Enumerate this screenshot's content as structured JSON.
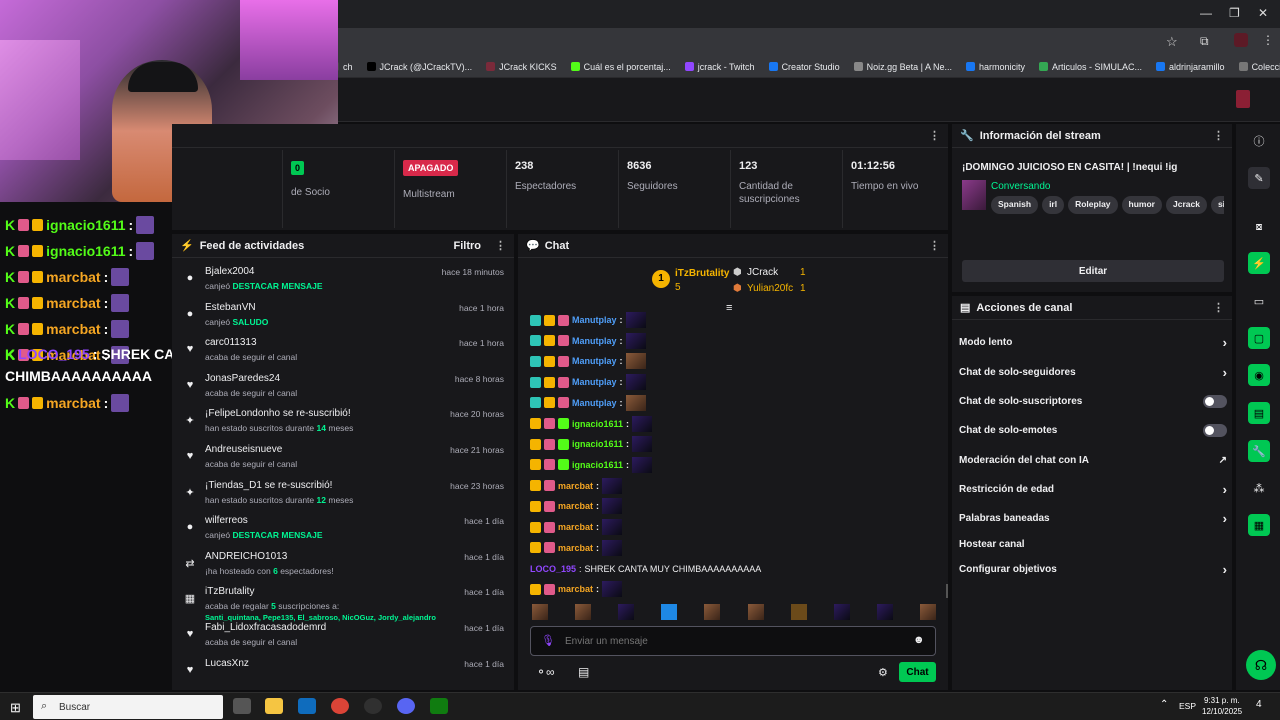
{
  "browser": {
    "bookmarks": [
      {
        "label": "ch",
        "color": "#444"
      },
      {
        "label": "JCrack (@JCrackTV)...",
        "color": "#000"
      },
      {
        "label": "JCrack KICKS",
        "color": "#7a2a3a"
      },
      {
        "label": "Cuál es el porcentaj...",
        "color": "#53fc18"
      },
      {
        "label": "jcrack - Twitch",
        "color": "#9147ff"
      },
      {
        "label": "Creator Studio",
        "color": "#1877f2"
      },
      {
        "label": "Noiz.gg Beta | A Ne...",
        "color": "#888"
      },
      {
        "label": "harmonicity",
        "color": "#1877f2"
      },
      {
        "label": "Articulos - SIMULAC...",
        "color": "#34a853"
      },
      {
        "label": "aldrinjaramillo",
        "color": "#1877f2"
      },
      {
        "label": "Colección de M_blei...",
        "color": "#777"
      }
    ],
    "more": "»"
  },
  "stats": {
    "items": [
      {
        "value": "0",
        "label": "de Socio"
      },
      {
        "value": "APAGADO",
        "label": "Multistream"
      },
      {
        "value": "238",
        "label": "Espectadores"
      },
      {
        "value": "8636",
        "label": "Seguidores"
      },
      {
        "value": "123",
        "label": "Cantidad de suscripciones"
      },
      {
        "value": "01:12:56",
        "label": "Tiempo en vivo"
      }
    ]
  },
  "activity": {
    "title": "Feed de actividades",
    "filter": "Filtro",
    "items": [
      {
        "name": "Bjalex2004",
        "desc": "canjeó",
        "highlight": "DESTACAR MENSAJE",
        "time": "hace 18 minutos",
        "icon": "●"
      },
      {
        "name": "EstebanVN",
        "desc": "canjeó",
        "highlight": "SALUDO",
        "time": "hace 1 hora",
        "icon": "●"
      },
      {
        "name": "carc011313",
        "desc": "acaba de seguir el canal",
        "highlight": "",
        "time": "hace 1 hora",
        "icon": "♥"
      },
      {
        "name": "JonasParedes24",
        "desc": "acaba de seguir el canal",
        "highlight": "",
        "time": "hace 8 horas",
        "icon": "♥"
      },
      {
        "name": "¡FelipeLondonho se re-suscribió!",
        "desc": "han estado suscritos durante",
        "highlight": "14",
        "suffix": "meses",
        "time": "hace 20 horas",
        "icon": "✦"
      },
      {
        "name": "Andreuseisnueve",
        "desc": "acaba de seguir el canal",
        "highlight": "",
        "time": "hace 21 horas",
        "icon": "♥"
      },
      {
        "name": "¡Tiendas_D1 se re-suscribió!",
        "desc": "han estado suscritos durante",
        "highlight": "12",
        "suffix": "meses",
        "time": "hace 23 horas",
        "icon": "✦"
      },
      {
        "name": "wilferreos",
        "desc": "canjeó",
        "highlight": "DESTACAR MENSAJE",
        "time": "hace 1 día",
        "icon": "●"
      },
      {
        "name": "ANDREICHO1013",
        "desc": "¡ha hosteado con",
        "highlight": "6",
        "suffix": "espectadores!",
        "time": "hace 1 día",
        "icon": "⇄"
      },
      {
        "name": "iTzBrutality",
        "desc": "acaba de regalar",
        "highlight": "5",
        "suffix": "suscripciones a:",
        "extra": "Santi_quintana, Pepe135, El_sabroso, NicOGuz, Jordy_alejandro",
        "time": "hace 1 día",
        "icon": "▦"
      },
      {
        "name": "Fabi_Lidoxfracasadodemrd",
        "desc": "acaba de seguir el canal",
        "highlight": "",
        "time": "hace 1 día",
        "icon": "♥"
      },
      {
        "name": "LucasXnz",
        "desc": "",
        "highlight": "",
        "time": "hace 1 día",
        "icon": "♥"
      }
    ]
  },
  "chat": {
    "title": "Chat",
    "top": {
      "first": {
        "name": "iTzBrutality",
        "count": "5"
      },
      "second": {
        "name": "JCrack",
        "count": "1"
      },
      "third": {
        "name": "Yulian20fc",
        "count": "1"
      }
    },
    "messages": [
      {
        "user": "Manutplay",
        "color": "#4f9ef8"
      },
      {
        "user": "Manutplay",
        "color": "#4f9ef8"
      },
      {
        "user": "Manutplay",
        "color": "#4f9ef8"
      },
      {
        "user": "Manutplay",
        "color": "#4f9ef8"
      },
      {
        "user": "Manutplay",
        "color": "#4f9ef8"
      },
      {
        "user": "ignacio1611",
        "color": "#53fc18"
      },
      {
        "user": "ignacio1611",
        "color": "#53fc18"
      },
      {
        "user": "ignacio1611",
        "color": "#53fc18"
      },
      {
        "user": "marcbat",
        "color": "#f5a623"
      },
      {
        "user": "marcbat",
        "color": "#f5a623"
      },
      {
        "user": "marcbat",
        "color": "#f5a623"
      },
      {
        "user": "marcbat",
        "color": "#f5a623"
      }
    ],
    "loco": {
      "user": "LOCO_195",
      "text": "SHREK CANTA MUY CHIMBAAAAAAAAAA"
    },
    "last": {
      "user": "marcbat",
      "color": "#f5a623"
    },
    "placeholder": "Enviar un mensaje",
    "send": "Chat"
  },
  "info": {
    "title": "Información del stream",
    "stream_title": "¡DOMINGO JUICIOSO EN CASITA! | !nequi !ig",
    "category": "Conversando",
    "tags": [
      "Spanish",
      "irl",
      "Roleplay",
      "humor",
      "Jcrack",
      "simula"
    ],
    "edit": "Editar"
  },
  "actions": {
    "title": "Acciones de canal",
    "items": [
      {
        "label": "Modo lento",
        "kind": "chev"
      },
      {
        "label": "Chat de solo-seguidores",
        "kind": "chev"
      },
      {
        "label": "Chat de solo-suscriptores",
        "kind": "toggle"
      },
      {
        "label": "Chat de solo-emotes",
        "kind": "toggle"
      },
      {
        "label": "Moderación del chat con IA",
        "kind": "ext"
      },
      {
        "label": "Restricción de edad",
        "kind": "chev"
      },
      {
        "label": "Palabras baneadas",
        "kind": "chev"
      },
      {
        "label": "Hostear canal",
        "kind": "none"
      },
      {
        "label": "Configurar objetivos",
        "kind": "chev"
      }
    ]
  },
  "overlay": {
    "lines": [
      {
        "user": "ignacio1611",
        "color": "#53fc18",
        "sep": ":"
      },
      {
        "user": "ignacio1611",
        "color": "#53fc18",
        "sep": ":"
      },
      {
        "user": "marcbat",
        "color": "#f5a623",
        "sep": ":"
      },
      {
        "user": "marcbat",
        "color": "#f5a623",
        "sep": ":"
      },
      {
        "user": "marcbat",
        "color": "#f5a623",
        "sep": ":"
      },
      {
        "user": "marcbat",
        "color": "#f5a623",
        "sep": ":"
      }
    ],
    "loco_user": "LOCO_195",
    "loco_text": ": SHREK CANTA MUY",
    "loco_text2": "CHIMBAAAAAAAAAA",
    "last_user": "marcbat"
  },
  "taskbar": {
    "search": "Buscar",
    "lang": "ESP",
    "time": "9:31 p. m.",
    "date": "12/10/2025",
    "notif": "4"
  }
}
